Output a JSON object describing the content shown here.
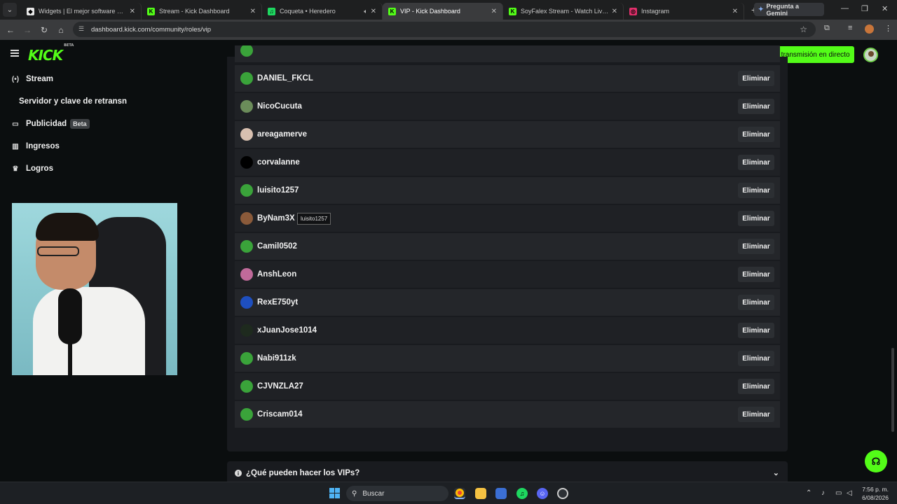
{
  "browser": {
    "tabs": [
      {
        "title": "Widgets | El mejor software para",
        "favicon_color": "#e8e8e8",
        "favicon_glyph": "◆"
      },
      {
        "title": "Stream - Kick Dashboard",
        "favicon_color": "#53fc18",
        "favicon_glyph": "K"
      },
      {
        "title": "Coqueta • Heredero",
        "favicon_color": "#1ed760",
        "favicon_glyph": "♫"
      },
      {
        "title": "VIP - Kick Dashboard",
        "favicon_color": "#53fc18",
        "favicon_glyph": "K",
        "active": true
      },
      {
        "title": "SoyFalex Stream - Watch Live o",
        "favicon_color": "#53fc18",
        "favicon_glyph": "K"
      },
      {
        "title": "Instagram",
        "favicon_color": "#e1306c",
        "favicon_glyph": "◎"
      }
    ],
    "gemini_label": "Pregunta a Gemini",
    "url": "dashboard.kick.com/community/roles/vip"
  },
  "header": {
    "logo_text": "KICK",
    "logo_beta": "BETA",
    "go_live_label": "Inicia la transmisión en directo"
  },
  "sidebar": {
    "items": [
      {
        "label": "Stream",
        "icon": "broadcast-icon"
      },
      {
        "label": "Servidor y clave de retransn",
        "sub": true
      },
      {
        "label": "Publicidad",
        "icon": "ad-icon",
        "badge": "Beta"
      },
      {
        "label": "Ingresos",
        "icon": "chart-icon"
      },
      {
        "label": "Logros",
        "icon": "trophy-icon"
      }
    ]
  },
  "vip_list": {
    "remove_label": "Eliminar",
    "users": [
      {
        "name": "DANIEL_FKCL",
        "avatar_color": "#3aa33a"
      },
      {
        "name": "NicoCucuta",
        "avatar_color": "#6b8c5a"
      },
      {
        "name": "areagamerve",
        "avatar_color": "#d8c0b0"
      },
      {
        "name": "corvalanne",
        "avatar_color": "#000000"
      },
      {
        "name": "luisito1257",
        "avatar_color": "#3aa33a"
      },
      {
        "name": "ByNam3X",
        "avatar_color": "#8a5a3a"
      },
      {
        "name": "Camil0502",
        "avatar_color": "#3aa33a"
      },
      {
        "name": "AnshLeon",
        "avatar_color": "#c06a9a"
      },
      {
        "name": "RexE750yt",
        "avatar_color": "#1e4fbf"
      },
      {
        "name": "xJuanJose1014",
        "avatar_color": "#1e2a1e"
      },
      {
        "name": "Nabi911zk",
        "avatar_color": "#3aa33a"
      },
      {
        "name": "CJVNZLA27",
        "avatar_color": "#3aa33a"
      },
      {
        "name": "Criscam014",
        "avatar_color": "#3aa33a"
      }
    ],
    "tooltip": "luisito1257"
  },
  "faq": {
    "title": "¿Qué pueden hacer los VIPs?"
  },
  "taskbar": {
    "search_placeholder": "Buscar",
    "time": "7:56 p. m.",
    "date": "6/08/2026"
  },
  "colors": {
    "accent": "#53fc18"
  }
}
